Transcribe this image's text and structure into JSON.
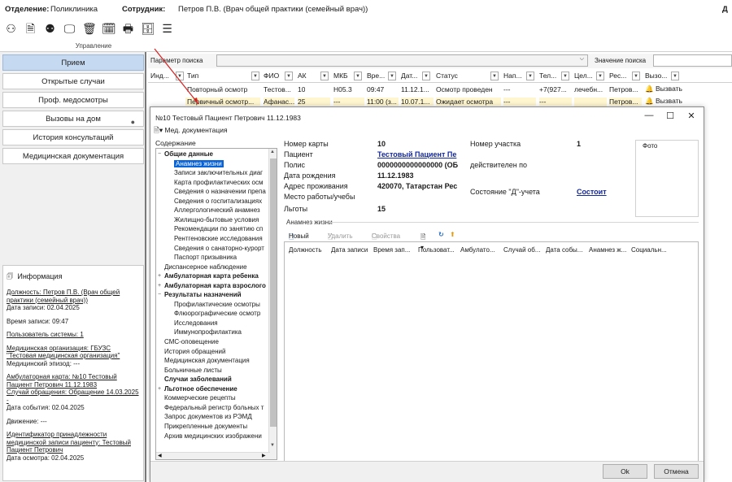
{
  "topbar": {
    "dept_label": "Отделение:",
    "dept_value": "Поликлиника",
    "emp_label": "Сотрудник:",
    "emp_value": "Петров П.В. (Врач общей практики (семейный врач))",
    "right_letter": "Д"
  },
  "toolbar": {
    "section_label": "Управление",
    "icons": [
      "user-icon",
      "document-edit-icon",
      "users-icon",
      "monitor-icon",
      "trash-icon",
      "calendar-icon",
      "print-icon",
      "archive-icon",
      "list-icon"
    ]
  },
  "nav": {
    "items": [
      {
        "label": "Прием"
      },
      {
        "label": "Открытые случаи"
      },
      {
        "label": "Проф. медосмотры"
      },
      {
        "label": "Вызовы на дом"
      },
      {
        "label": "История консультаций"
      },
      {
        "label": "Медицинская документация"
      }
    ]
  },
  "info": {
    "title": "Информация",
    "position": "Должность: Петров П.В. (Врач общей",
    "position2": "практики (семейный врач))",
    "record_date": "Дата записи: 02.04.2025",
    "record_time": "Время записи: 09:47",
    "system_user": "Пользователь системы: 1",
    "med_org": "Медицинская организация: ГБУЗС",
    "med_org2": "\"Тестовая медицинская организация\"",
    "episode": "Медицинский эпизод: ---",
    "card": "Амбулаторная карта: №10 Тестовый",
    "card2": "Пациент Петрович 11.12.1983",
    "appeal": "Случай обращения: Обращение 14.03.2025",
    "appeal_dash": "-",
    "event_date": "Дата события: 02.04.2025",
    "movement": "Движение: ---",
    "ident": "Идентификатор принадлежности",
    "ident2": "медицинской записи пациенту: Тестовый",
    "ident3": "Пациент Петрович",
    "exam_date": "Дата осмотра: 02.04.2025"
  },
  "search": {
    "param_label": "Параметр поиска",
    "value_label": "Значение поиска"
  },
  "grid": {
    "headers": [
      "Инд...",
      "Тип",
      "ФИО",
      "АК",
      "МКБ",
      "Вре...",
      "Дат...",
      "Статус",
      "Нап...",
      "Тел...",
      "Цел...",
      "Рес...",
      "Вызо..."
    ],
    "rows": [
      {
        "type": "Повторный осмотр",
        "fio": "Тестов...",
        "ak": "10",
        "mkb": "H05.3",
        "time": "09:47",
        "date": "11.12.1...",
        "status": "Осмотр проведен",
        "nap": "---",
        "tel": "+7(927...",
        "cel": "лечебн...",
        "res": "Петров...",
        "call": "Вызвать"
      },
      {
        "type": "Первичный осмотр...",
        "fio": "Афанас...",
        "ak": "25",
        "mkb": "---",
        "time": "11:00 (з...",
        "date": "10.07.1...",
        "status": "Ожидает осмотра",
        "nap": "---",
        "tel": "---",
        "cel": "",
        "res": "Петров...",
        "call": "Вызвать"
      }
    ]
  },
  "dialog": {
    "title": "№10 Тестовый Пациент Петрович 11.12.1983",
    "menu": "Мед. документация",
    "tree_title": "Содержание",
    "tree": [
      {
        "label": "Общие данные",
        "bold": true,
        "level": 0,
        "expand": "−"
      },
      {
        "label": "Анамнез жизни",
        "level": 1,
        "selected": true
      },
      {
        "label": "Записи заключительных диаг",
        "level": 1
      },
      {
        "label": "Карта профилактических осм",
        "level": 1
      },
      {
        "label": "Сведения о назначении препа",
        "level": 1
      },
      {
        "label": "Сведения о госпитализациях",
        "level": 1
      },
      {
        "label": "Аллергологический анамнез",
        "level": 1
      },
      {
        "label": "Жилищно-бытовые условия",
        "level": 1
      },
      {
        "label": "Рекомендации по занятию сп",
        "level": 1
      },
      {
        "label": "Рентгеновские исследования",
        "level": 1
      },
      {
        "label": "Сведения о санаторно-курорт",
        "level": 1
      },
      {
        "label": "Паспорт призывника",
        "level": 1
      },
      {
        "label": "Диспансерное наблюдение",
        "level": 0
      },
      {
        "label": "Амбулаторная карта ребенка",
        "bold": true,
        "level": 0,
        "expand": "+"
      },
      {
        "label": "Амбулаторная карта взрослого",
        "bold": true,
        "level": 0,
        "expand": "+"
      },
      {
        "label": "Результаты назначений",
        "bold": true,
        "level": 0,
        "expand": "−"
      },
      {
        "label": "Профилактические осмотры",
        "level": 1
      },
      {
        "label": "Флюорографические осмотр",
        "level": 1
      },
      {
        "label": "Исследования",
        "level": 1
      },
      {
        "label": "Иммунопрофилактика",
        "level": 1
      },
      {
        "label": "СМС-оповещение",
        "level": 0
      },
      {
        "label": "История обращений",
        "level": 0
      },
      {
        "label": "Медицинская документация",
        "level": 0
      },
      {
        "label": "Больничные листы",
        "level": 0
      },
      {
        "label": "Случаи заболеваний",
        "bold": true,
        "level": 0
      },
      {
        "label": "Льготное обеспечение",
        "bold": true,
        "level": 0,
        "expand": "+"
      },
      {
        "label": "Коммерческие рецепты",
        "level": 0
      },
      {
        "label": "Федеральный регистр больных т",
        "level": 0
      },
      {
        "label": "Запрос документов из РЭМД",
        "level": 0
      },
      {
        "label": "Прикрепленные документы",
        "level": 0
      },
      {
        "label": "Архив медицинских изображени",
        "level": 0
      }
    ],
    "patient": {
      "card_label": "Номер карты",
      "card_value": "10",
      "patient_label": "Пациент",
      "patient_value": "Тестовый Пациент Пе",
      "policy_label": "Полис",
      "policy_value": "0000000000000000 (ОБ",
      "policy_valid": "действителен по",
      "birth_label": "Дата рождения",
      "birth_value": "11.12.1983",
      "address_label": "Адрес проживания",
      "address_value": "420070, Татарстан Рес",
      "work_label": "Место работы/учебы",
      "benefits_label": "Льготы",
      "benefits_value": "15",
      "plot_label": "Номер участка",
      "plot_value": "1",
      "d_label": "Состояние \"Д\"-учета",
      "d_value": "Состоит",
      "photo_label": "Фото"
    },
    "anamnesis": {
      "title": "Анамнез жизни",
      "tools": {
        "new": "Новый",
        "delete": "Удалить",
        "props": "Свойства"
      },
      "columns": [
        "Должность",
        "Дата записи",
        "Время зап...",
        "Пользоват...",
        "Амбулато...",
        "Случай об...",
        "Дата собы...",
        "Анамнез ж...",
        "Социальн..."
      ]
    },
    "ok": "Ok",
    "cancel": "Отмена"
  }
}
